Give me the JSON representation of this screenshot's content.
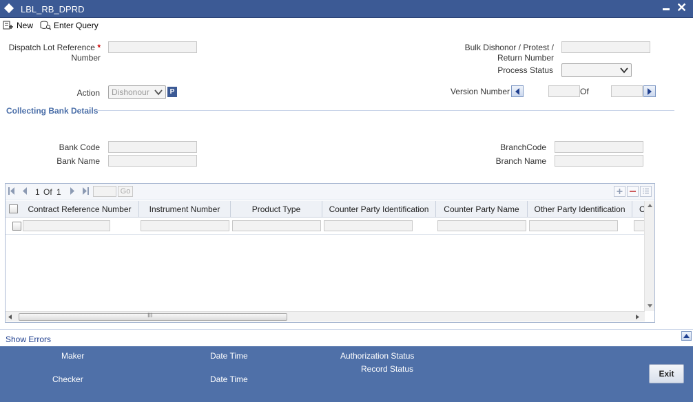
{
  "window": {
    "title": "LBL_RB_DPRD"
  },
  "toolbar": {
    "new_label": "New",
    "enter_query_label": "Enter Query"
  },
  "form": {
    "dispatch_lot_label_1": "Dispatch Lot Reference",
    "dispatch_lot_label_2": "Number",
    "required_mark": "*",
    "bulk_label_1": "Bulk Dishonor / Protest /",
    "bulk_label_2": "Return Number",
    "process_status_label": "Process Status",
    "process_status_value": "",
    "action_label": "Action",
    "action_value": "Dishonour",
    "p_button": "P",
    "version_label": "Version Number",
    "of_label": "Of"
  },
  "collecting_bank": {
    "title": "Collecting Bank Details",
    "bank_code_label": "Bank Code",
    "bank_name_label": "Bank Name",
    "branch_code_label": "BranchCode",
    "branch_name_label": "Branch Name"
  },
  "grid": {
    "page_current": "1",
    "page_of": "Of",
    "page_total": "1",
    "go_label": "Go",
    "columns": [
      "Contract Reference Number",
      "Instrument Number",
      "Product Type",
      "Counter Party Identification",
      "Counter Party Name",
      "Other Party Identification",
      "C"
    ],
    "hscroll_grip": "III"
  },
  "show_errors_label": "Show Errors",
  "footer": {
    "maker_label": "Maker",
    "checker_label": "Checker",
    "date_time_label_1": "Date Time",
    "date_time_label_2": "Date Time",
    "authorization_status_label": "Authorization Status",
    "record_status_label": "Record Status",
    "exit_label": "Exit"
  },
  "colors": {
    "titlebar": "#3c5a95",
    "footer": "#4f70a8",
    "section_title": "#4a6ea8",
    "link": "#1f3f8f"
  }
}
